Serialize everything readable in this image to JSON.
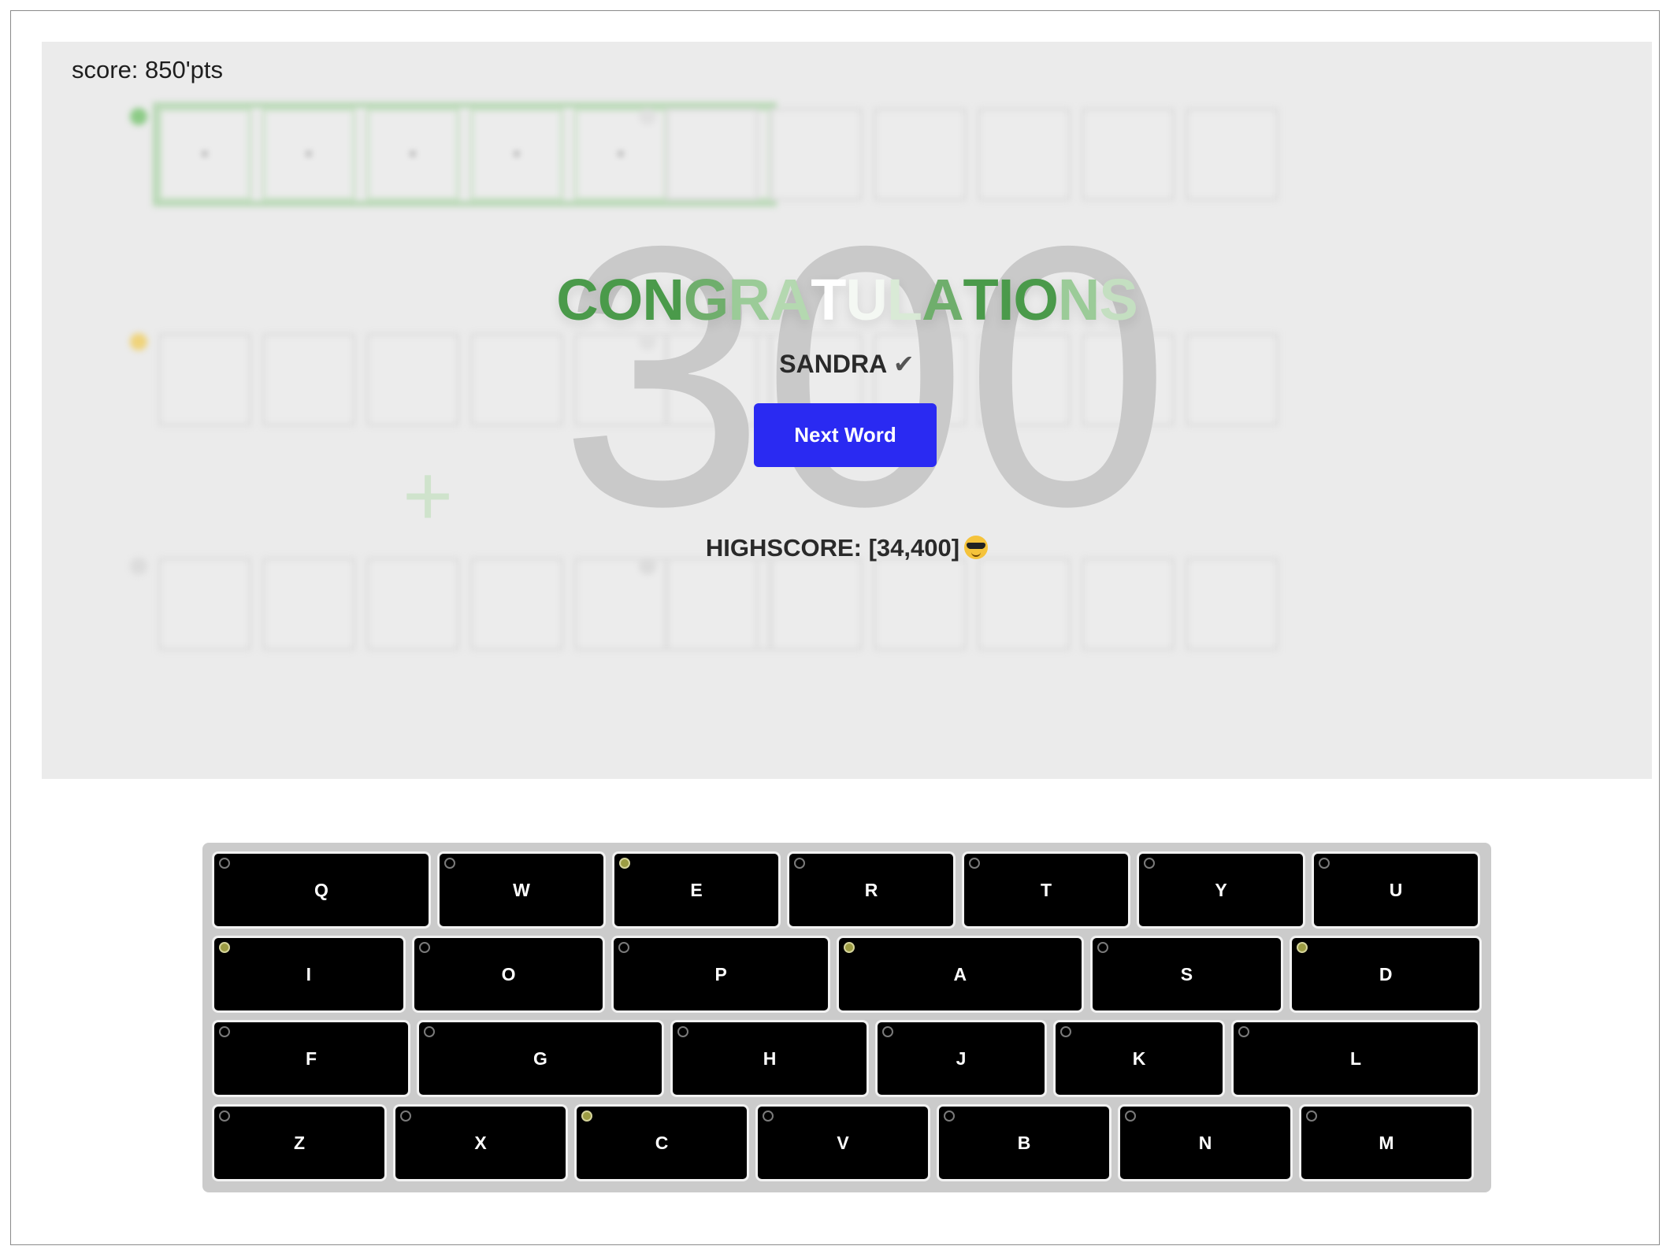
{
  "game": {
    "score_text": "score: 850'pts",
    "big_number": "300",
    "plus_sign": "+",
    "congrats_letters": [
      "C",
      "O",
      "N",
      "G",
      "R",
      "A",
      "T",
      "U",
      "L",
      "A",
      "T",
      "I",
      "O",
      "N",
      "S"
    ],
    "congrats_colors": [
      "#4a9a4a",
      "#4a9a4a",
      "#4a9a4a",
      "#6fae6c",
      "#9bcb98",
      "#b4d8b0",
      "#ffffff",
      "#f4f8f3",
      "#d9ead6",
      "#6fae6c",
      "#4a9a4a",
      "#4a9a4a",
      "#4a9a4a",
      "#9bcb98",
      "#c4dfc1"
    ],
    "winner_name": "SANDRA",
    "winner_check": "✔",
    "next_button_label": "Next Word",
    "highscore_text": "HIGHSCORE: [34,400]",
    "highscore_emoji": "smiling-face-with-sunglasses-icon",
    "boards": [
      {
        "letters": [
          "",
          "",
          "",
          "",
          "",
          ""
        ],
        "status": "solved",
        "dot_color": "#8ccb86"
      },
      {
        "letters": [
          "",
          "",
          "",
          "",
          "",
          ""
        ],
        "status": "empty",
        "dot_color": "#e1e1e1"
      },
      {
        "letters": [
          "",
          "",
          "",
          "",
          "",
          ""
        ],
        "status": "empty",
        "dot_color": "#efd37a"
      },
      {
        "letters": [
          "",
          "",
          "",
          "",
          "",
          ""
        ],
        "status": "empty",
        "dot_color": "#e1e1e1"
      },
      {
        "letters": [
          "",
          "",
          "",
          "",
          "",
          ""
        ],
        "status": "empty",
        "dot_color": "#dcdcdc"
      },
      {
        "letters": [
          "",
          "",
          "",
          "",
          "",
          ""
        ],
        "status": "empty",
        "dot_color": "#dcdcdc"
      }
    ],
    "solved_board_marks": [
      "•",
      "•",
      "•",
      "•",
      "•",
      "•"
    ]
  },
  "keyboard": {
    "used_color": "#9c9c43",
    "rows": [
      [
        {
          "label": "Q",
          "used": false
        },
        {
          "label": "W",
          "used": false
        },
        {
          "label": "E",
          "used": true
        },
        {
          "label": "R",
          "used": false
        },
        {
          "label": "T",
          "used": false
        },
        {
          "label": "Y",
          "used": false
        },
        {
          "label": "U",
          "used": false
        }
      ],
      [
        {
          "label": "I",
          "used": true
        },
        {
          "label": "O",
          "used": false
        },
        {
          "label": "P",
          "used": false
        },
        {
          "label": "A",
          "used": true
        },
        {
          "label": "S",
          "used": false
        },
        {
          "label": "D",
          "used": true
        }
      ],
      [
        {
          "label": "F",
          "used": false
        },
        {
          "label": "G",
          "used": false
        },
        {
          "label": "H",
          "used": false
        },
        {
          "label": "J",
          "used": false
        },
        {
          "label": "K",
          "used": false
        },
        {
          "label": "L",
          "used": false
        }
      ],
      [
        {
          "label": "Z",
          "used": false
        },
        {
          "label": "X",
          "used": false
        },
        {
          "label": "C",
          "used": true
        },
        {
          "label": "V",
          "used": false
        },
        {
          "label": "B",
          "used": false
        },
        {
          "label": "N",
          "used": false
        },
        {
          "label": "M",
          "used": false
        }
      ]
    ]
  }
}
